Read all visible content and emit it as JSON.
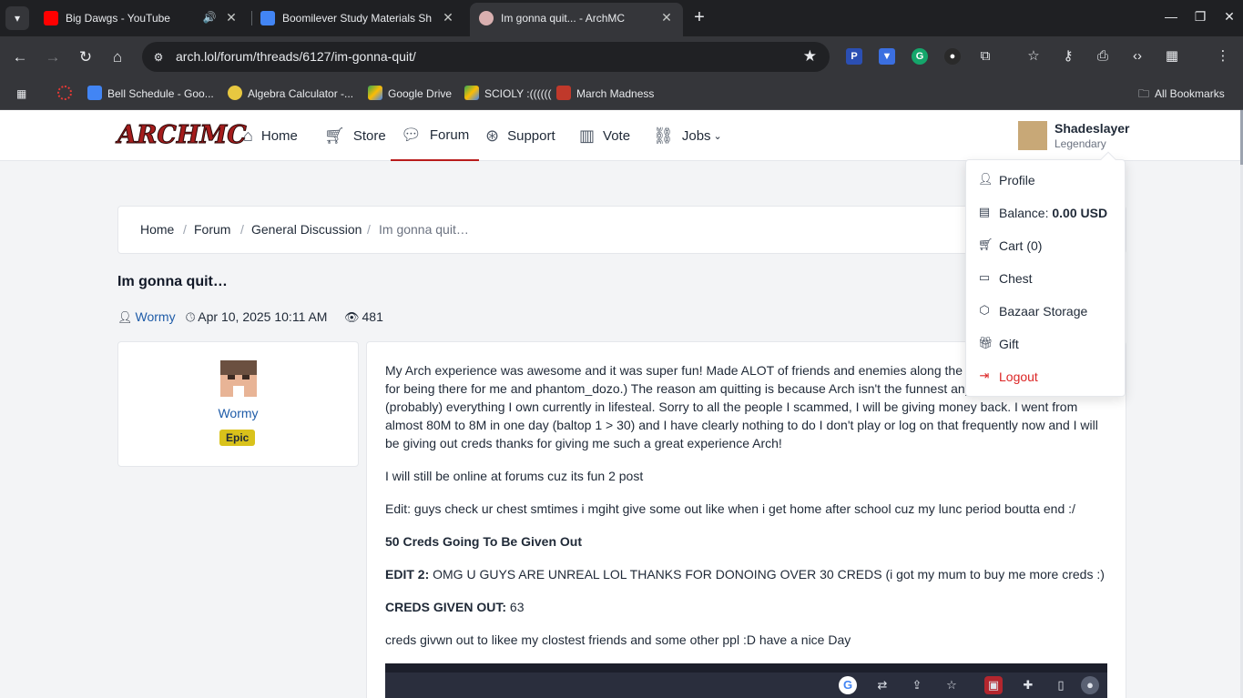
{
  "browser": {
    "tabs": [
      {
        "title": "Big Dawgs - YouTube"
      },
      {
        "title": "Boomilever Study Materials Sh"
      },
      {
        "title": "Im gonna quit... - ArchMC"
      }
    ],
    "url": "arch.lol/forum/threads/6127/im-gonna-quit/",
    "bookmarks": [
      {
        "label": "Bell Schedule - Goo..."
      },
      {
        "label": "Algebra Calculator -..."
      },
      {
        "label": "Google Drive"
      },
      {
        "label": "SCIOLY :(((((("
      },
      {
        "label": "March Madness"
      }
    ],
    "all_bookmarks": "All Bookmarks"
  },
  "site": {
    "logo": "ARCHMC",
    "nav": [
      {
        "label": "Home"
      },
      {
        "label": "Store"
      },
      {
        "label": "Forum"
      },
      {
        "label": "Support"
      },
      {
        "label": "Vote"
      },
      {
        "label": "Jobs"
      }
    ],
    "user": {
      "name": "Shadeslayer",
      "rank": "Legendary"
    }
  },
  "breadcrumb": [
    "Home",
    "Forum",
    "General Discussion",
    "Im gonna quit…"
  ],
  "thread": {
    "title": "Im gonna quit…",
    "author": "Wormy",
    "date": "Apr 10, 2025 10:11 AM",
    "views": "481"
  },
  "author_card": {
    "name": "Wormy",
    "badge": "Epic"
  },
  "post": {
    "p1_line1": "My Arch experience was awesome and it was super fun! Made ALOT of friends and enemies along the w",
    "p1_line2": "for being there for me and phantom_dozo.) The reason am quitting is because Arch isn't the funnest any",
    "p1_line3": "(probably) everything I own currently in lifesteal. Sorry to all the people I scammed, I will be giving money back. I went from",
    "p1_line4": "almost 80M to 8M in one day (baltop 1 > 30) and I have clearly nothing to do I don't play or log on that frequently now and I will",
    "p1_line5": "be giving out creds thanks for giving me such a great experience Arch!",
    "p2": "I will still be online at forums cuz its fun 2 post",
    "p3": "Edit: guys check ur chest smtimes i mgiht give some out like when i get home after school cuz my lunc period boutta end :/",
    "p4": "50 Creds Going To Be Given Out",
    "p5_label": "EDIT 2:",
    "p5_text": " OMG U GUYS ARE UNREAL LOL THANKS FOR DONOING OVER 30 CREDS (i got my mum to buy me more creds :)",
    "p6_label": "CREDS GIVEN OUT:",
    "p6_text": " 63",
    "p7": "creds givwn out to likee my clostest friends and some other ppl :D have a nice Day"
  },
  "dropdown": {
    "profile": "Profile",
    "balance_label": "Balance: ",
    "balance_value": "0.00 USD",
    "cart": "Cart (0)",
    "chest": "Chest",
    "bazaar": "Bazaar Storage",
    "gift": "Gift",
    "logout": "Logout"
  },
  "colors": {
    "brand": "#b91c1c",
    "link": "#1f5ca8",
    "badge_epic": "#d9c21b",
    "logout": "#dc2626"
  }
}
